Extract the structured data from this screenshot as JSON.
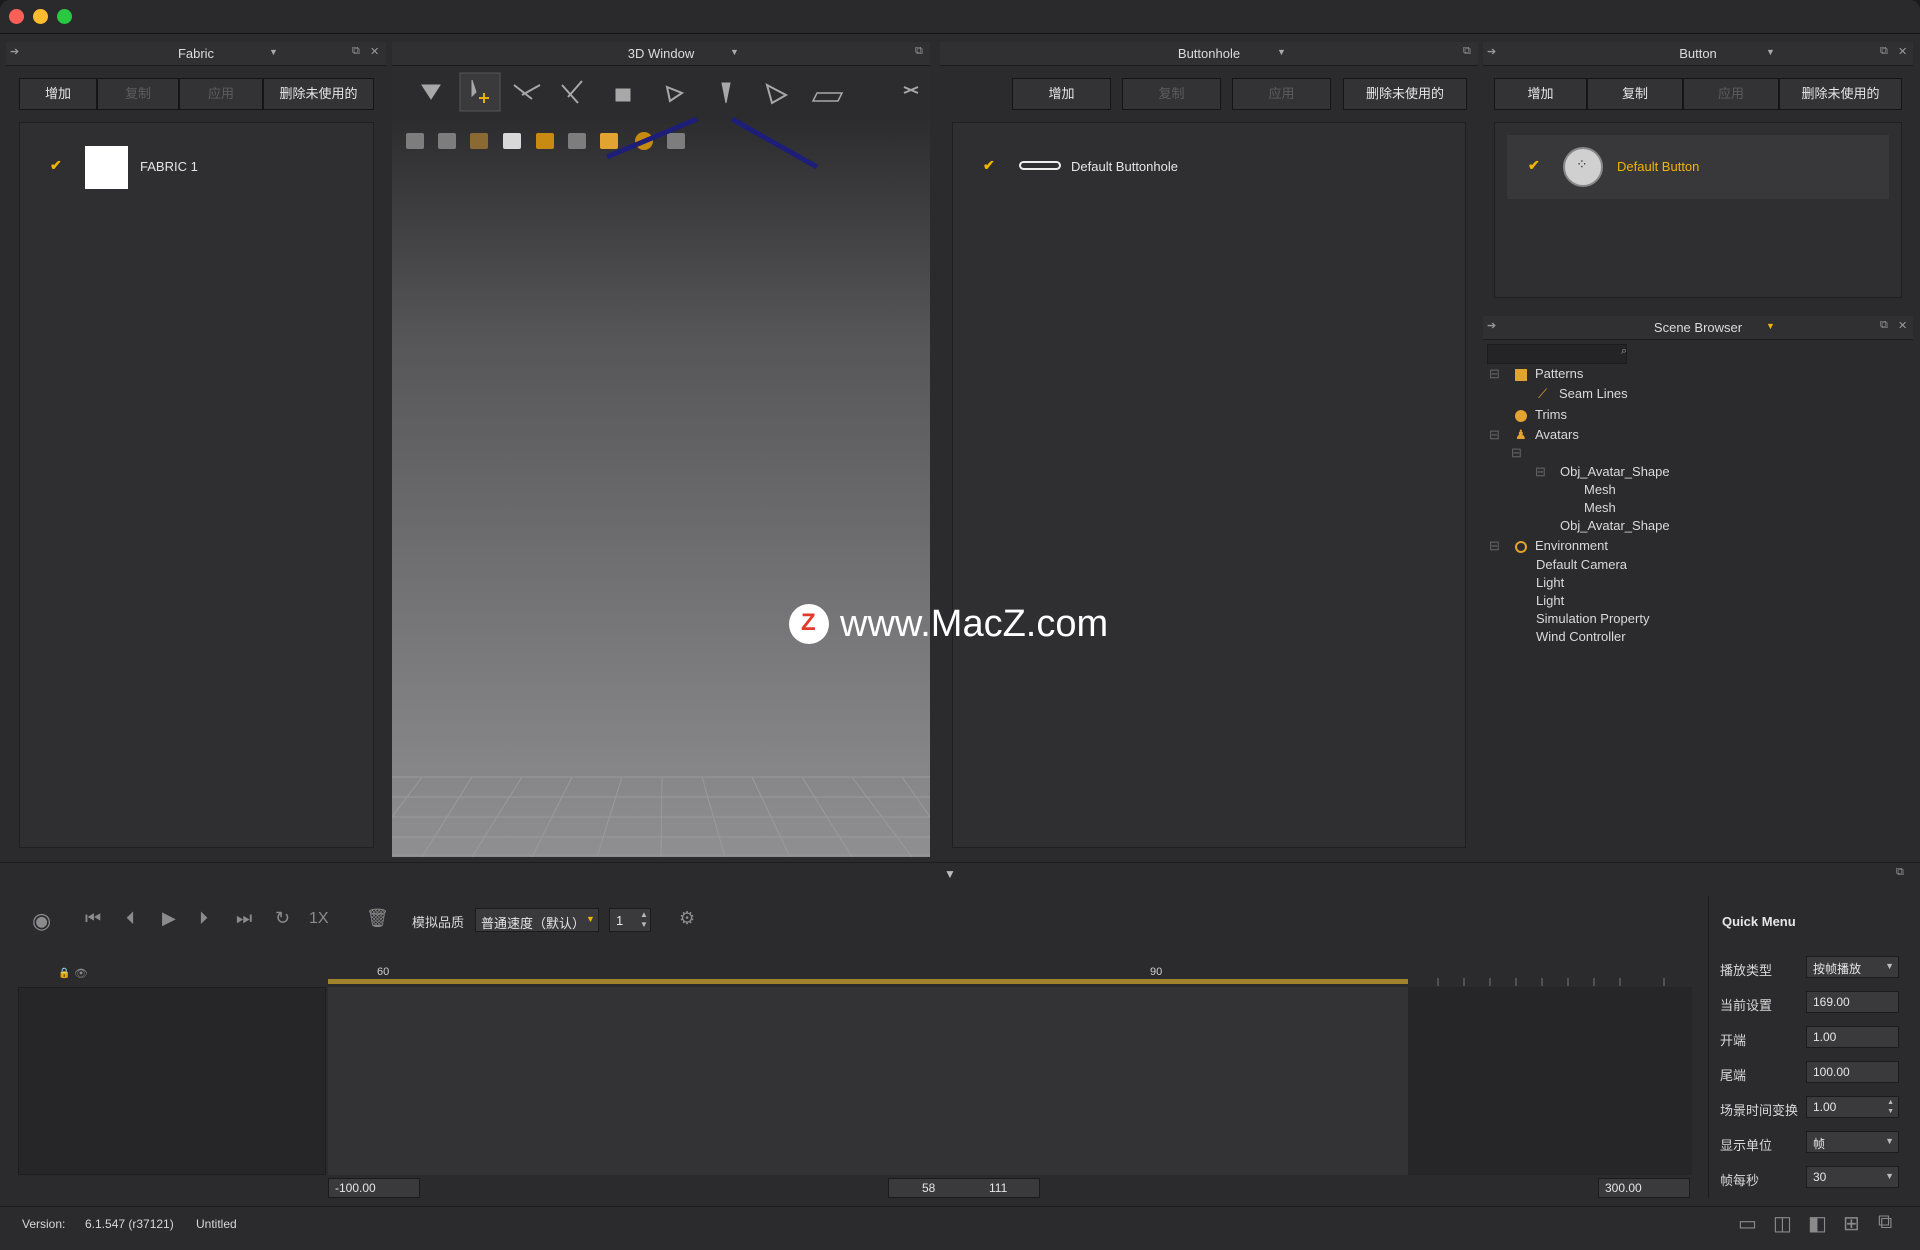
{
  "fabric": {
    "title": "Fabric",
    "buttons": [
      "增加",
      "复制",
      "应用",
      "删除未使用的"
    ],
    "item": "FABRIC 1"
  },
  "window3d": {
    "title": "3D Window"
  },
  "buttonhole": {
    "title": "Buttonhole",
    "buttons": [
      "增加",
      "复制",
      "应用",
      "删除未使用的"
    ],
    "item": "Default Buttonhole"
  },
  "button": {
    "title": "Button",
    "buttons": [
      "增加",
      "复制",
      "应用",
      "删除未使用的"
    ],
    "item": "Default Button"
  },
  "scene": {
    "title": "Scene Browser",
    "tree": [
      {
        "label": "Patterns"
      },
      {
        "label": "Seam Lines"
      },
      {
        "label": "Trims"
      },
      {
        "label": "Avatars"
      },
      {
        "label": "Obj_Avatar_Shape"
      },
      {
        "label": "Mesh"
      },
      {
        "label": "Mesh"
      },
      {
        "label": "Obj_Avatar_Shape"
      },
      {
        "label": "Environment"
      },
      {
        "label": "Default Camera"
      },
      {
        "label": "Light"
      },
      {
        "label": "Light"
      },
      {
        "label": "Simulation Property"
      },
      {
        "label": "Wind Controller"
      }
    ]
  },
  "watermark": "www.MacZ.com",
  "timeline": {
    "speed_label": "1X",
    "quality_label": "模拟品质",
    "quality_value": "普通速度（默认）",
    "step_value": "1",
    "tick_60": "60",
    "tick_90": "90",
    "range_start": "-100.00",
    "range_end": "300.00",
    "handle_left": "58",
    "handle_right": "111"
  },
  "quickmenu": {
    "title": "Quick Menu",
    "rows": [
      {
        "label": "播放类型",
        "value": "按帧播放"
      },
      {
        "label": "当前设置",
        "value": "169.00"
      },
      {
        "label": "开端",
        "value": "1.00"
      },
      {
        "label": "尾端",
        "value": "100.00"
      },
      {
        "label": "场景时间变换",
        "value": "1.00"
      },
      {
        "label": "显示单位",
        "value": "帧"
      },
      {
        "label": "帧每秒",
        "value": "30"
      }
    ]
  },
  "status": {
    "version_label": "Version:",
    "version_value": "6.1.547 (r37121)",
    "file": "Untitled"
  },
  "colors": {
    "accent": "#f0b400",
    "panel_bg": "#2b2b2d",
    "list_bg": "#2f2f31"
  }
}
